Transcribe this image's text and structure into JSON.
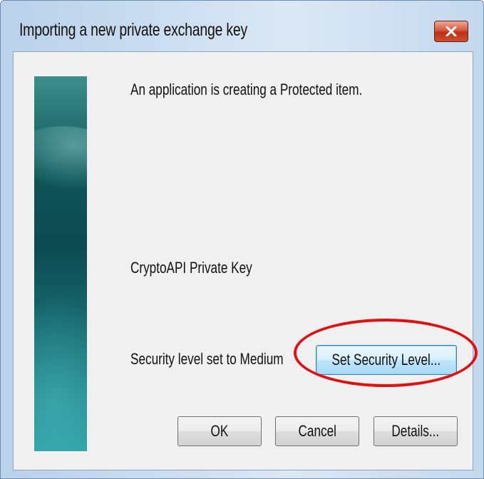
{
  "window": {
    "title": "Importing a new private exchange key"
  },
  "icons": {
    "close": "close-icon"
  },
  "colors": {
    "highlight": "#e01010",
    "close_button": "#c9452a",
    "side_graphic": "#0f5458"
  },
  "message": {
    "heading": "An application is creating a Protected item.",
    "item_name": "CryptoAPI Private Key",
    "security_level": "Security level set to Medium"
  },
  "buttons": {
    "set_security_level": "Set Security Level...",
    "ok": "OK",
    "cancel": "Cancel",
    "details": "Details..."
  }
}
